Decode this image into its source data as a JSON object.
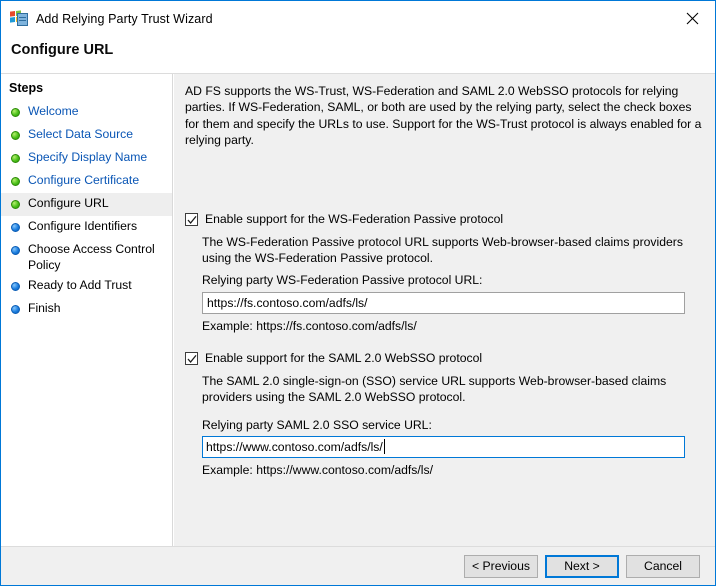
{
  "window": {
    "title": "Add Relying Party Trust Wizard",
    "icon": "adfs-wizard-icon",
    "close_label": "Close",
    "header_title": "Configure URL"
  },
  "sidebar": {
    "title": "Steps",
    "items": [
      {
        "label": "Welcome",
        "state": "done"
      },
      {
        "label": "Select Data Source",
        "state": "done"
      },
      {
        "label": "Specify Display Name",
        "state": "done"
      },
      {
        "label": "Configure Certificate",
        "state": "done"
      },
      {
        "label": "Configure URL",
        "state": "current"
      },
      {
        "label": "Configure Identifiers",
        "state": "pending"
      },
      {
        "label": "Choose Access Control Policy",
        "state": "pending"
      },
      {
        "label": "Ready to Add Trust",
        "state": "pending"
      },
      {
        "label": "Finish",
        "state": "pending"
      }
    ]
  },
  "content": {
    "intro": "AD FS supports the WS-Trust, WS-Federation and SAML 2.0 WebSSO protocols for relying parties.  If WS-Federation, SAML, or both are used by the relying party, select the check boxes for them and specify the URLs to use.  Support for the WS-Trust protocol is always enabled for a relying party.",
    "wsfed": {
      "checkbox_label": "Enable support for the WS-Federation Passive protocol",
      "checked": true,
      "description": "The WS-Federation Passive protocol URL supports Web-browser-based claims providers using the WS-Federation Passive protocol.",
      "field_label": "Relying party WS-Federation Passive protocol URL:",
      "value": "https://fs.contoso.com/adfs/ls/",
      "placeholder": "",
      "example": "Example: https://fs.contoso.com/adfs/ls/"
    },
    "saml": {
      "checkbox_label": "Enable support for the SAML 2.0 WebSSO protocol",
      "checked": true,
      "description": "The SAML 2.0 single-sign-on (SSO) service URL supports Web-browser-based claims providers using the SAML 2.0 WebSSO protocol.",
      "field_label": "Relying party SAML 2.0 SSO service URL:",
      "value": "https://www.contoso.com/adfs/ls/",
      "placeholder": "",
      "example": "Example: https://www.contoso.com/adfs/ls/"
    }
  },
  "footer": {
    "previous_label": "< Previous",
    "next_label": "Next >",
    "cancel_label": "Cancel"
  },
  "colors": {
    "accent": "#0078d7",
    "link": "#0a56b5",
    "done_dot": "#4bc11a",
    "pending_dot": "#1d7fe0",
    "content_bg": "#f0f0f0"
  }
}
